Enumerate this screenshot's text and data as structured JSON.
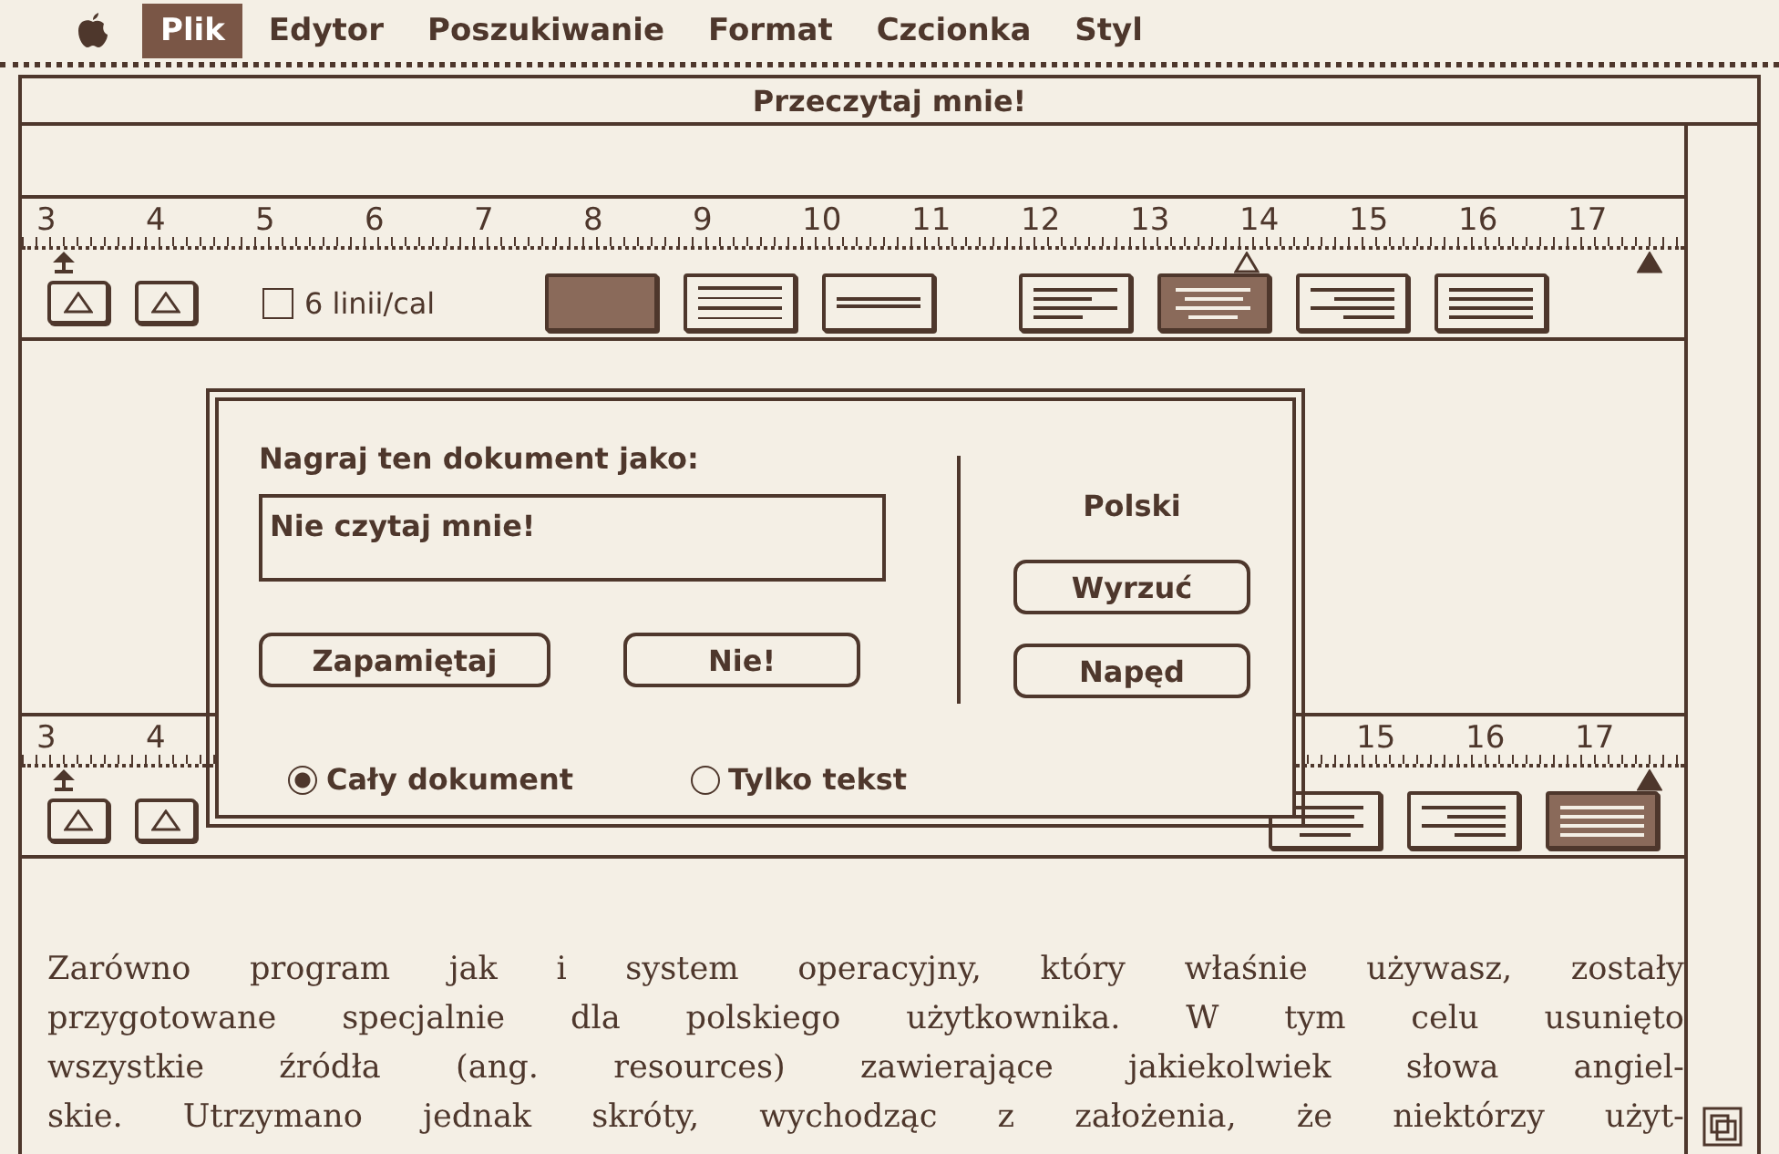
{
  "menu_bar": {
    "items": [
      {
        "label": "Plik",
        "selected": true
      },
      {
        "label": "Edytor",
        "selected": false
      },
      {
        "label": "Poszukiwanie",
        "selected": false
      },
      {
        "label": "Format",
        "selected": false
      },
      {
        "label": "Czcionka",
        "selected": false
      },
      {
        "label": "Styl",
        "selected": false
      }
    ]
  },
  "window": {
    "title": "Przeczytaj mnie!"
  },
  "ruler_top": {
    "numbers": [
      "3",
      "4",
      "5",
      "6",
      "7",
      "8",
      "9",
      "10",
      "11",
      "12",
      "13",
      "14",
      "15",
      "16",
      "17"
    ],
    "checkbox": {
      "label": "6 linii/cal",
      "checked": false
    },
    "spacing_buttons": [
      {
        "selected": true
      },
      {
        "selected": false
      },
      {
        "selected": false
      }
    ],
    "align_buttons": [
      {
        "selected": false
      },
      {
        "selected": true
      },
      {
        "selected": false
      },
      {
        "selected": false
      }
    ]
  },
  "ruler_bottom": {
    "left_numbers": [
      "3",
      "4"
    ],
    "right_numbers": [
      "15",
      "16",
      "17"
    ],
    "align_buttons": [
      {
        "selected": false
      },
      {
        "selected": false
      },
      {
        "selected": true
      }
    ]
  },
  "dialog": {
    "prompt": "Nagraj ten dokument jako:",
    "filename": "Nie czytaj mnie!",
    "disk": "Polski",
    "buttons": [
      "Zapamiętaj",
      "Nie!"
    ],
    "disk_buttons": [
      "Wyrzuć",
      "Napęd"
    ],
    "options": [
      {
        "label": "Cały dokument",
        "selected": true
      },
      {
        "label": "Tylko tekst",
        "selected": false
      }
    ]
  },
  "body": {
    "lines": [
      "Zarówno program jak i system operacyjny, który właśnie używasz, zostały",
      "przygotowane specjalnie dla polskiego użytkownika. W tym celu usunięto",
      "wszystkie źródła (ang. resources) zawierające jakiekolwiek słowa angiel-",
      "skie. Utrzymano jednak skróty, wychodząc z założenia, że niektórzy użyt-"
    ]
  }
}
